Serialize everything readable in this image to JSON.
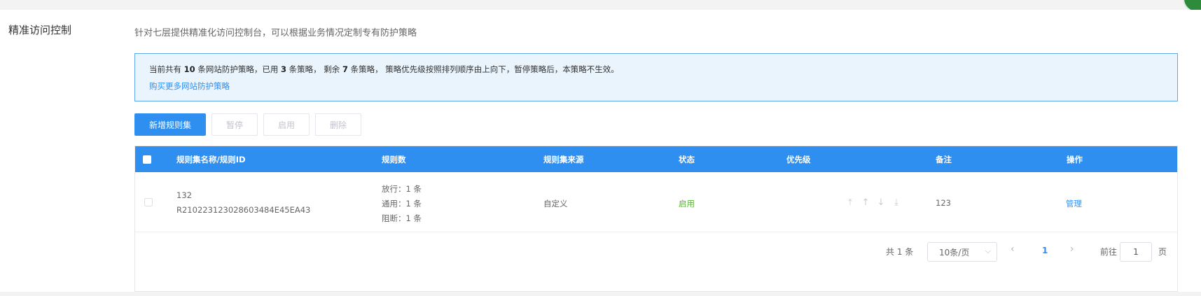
{
  "section": {
    "title": "精准访问控制",
    "description": "针对七层提供精准化访问控制台，可以根据业务情况定制专有防护策略"
  },
  "notice": {
    "prefix": "当前共有 ",
    "total": "10",
    "mid1": " 条网站防护策略，已用 ",
    "used": "3",
    "mid2": " 条策略， 剩余 ",
    "remaining": "7",
    "suffix": " 条策略， 策略优先级按照排列顺序由上向下，暂停策略后，本策略不生效。",
    "link": "购买更多网站防护策略"
  },
  "toolbar": {
    "add": "新增规则集",
    "pause": "暂停",
    "enable": "启用",
    "delete": "删除"
  },
  "table": {
    "headers": {
      "name": "规则集名称/规则ID",
      "count": "规则数",
      "source": "规则集来源",
      "status": "状态",
      "priority": "优先级",
      "remark": "备注",
      "action": "操作"
    },
    "rows": [
      {
        "name": "132",
        "id": "R210223123028603484E45EA43",
        "rules": [
          "放行：1 条",
          "通用：1 条",
          "阻断：1 条"
        ],
        "source": "自定义",
        "status": "启用",
        "remark": "123",
        "action": "管理"
      }
    ]
  },
  "pagination": {
    "total": "共 1 条",
    "page_size": "10条/页",
    "current": "1",
    "goto_label": "前往",
    "goto_value": "1",
    "page_unit": "页"
  },
  "colors": {
    "primary": "#2f8ff0",
    "status_on": "#57b431",
    "notice_bg": "#eaf4fd"
  }
}
